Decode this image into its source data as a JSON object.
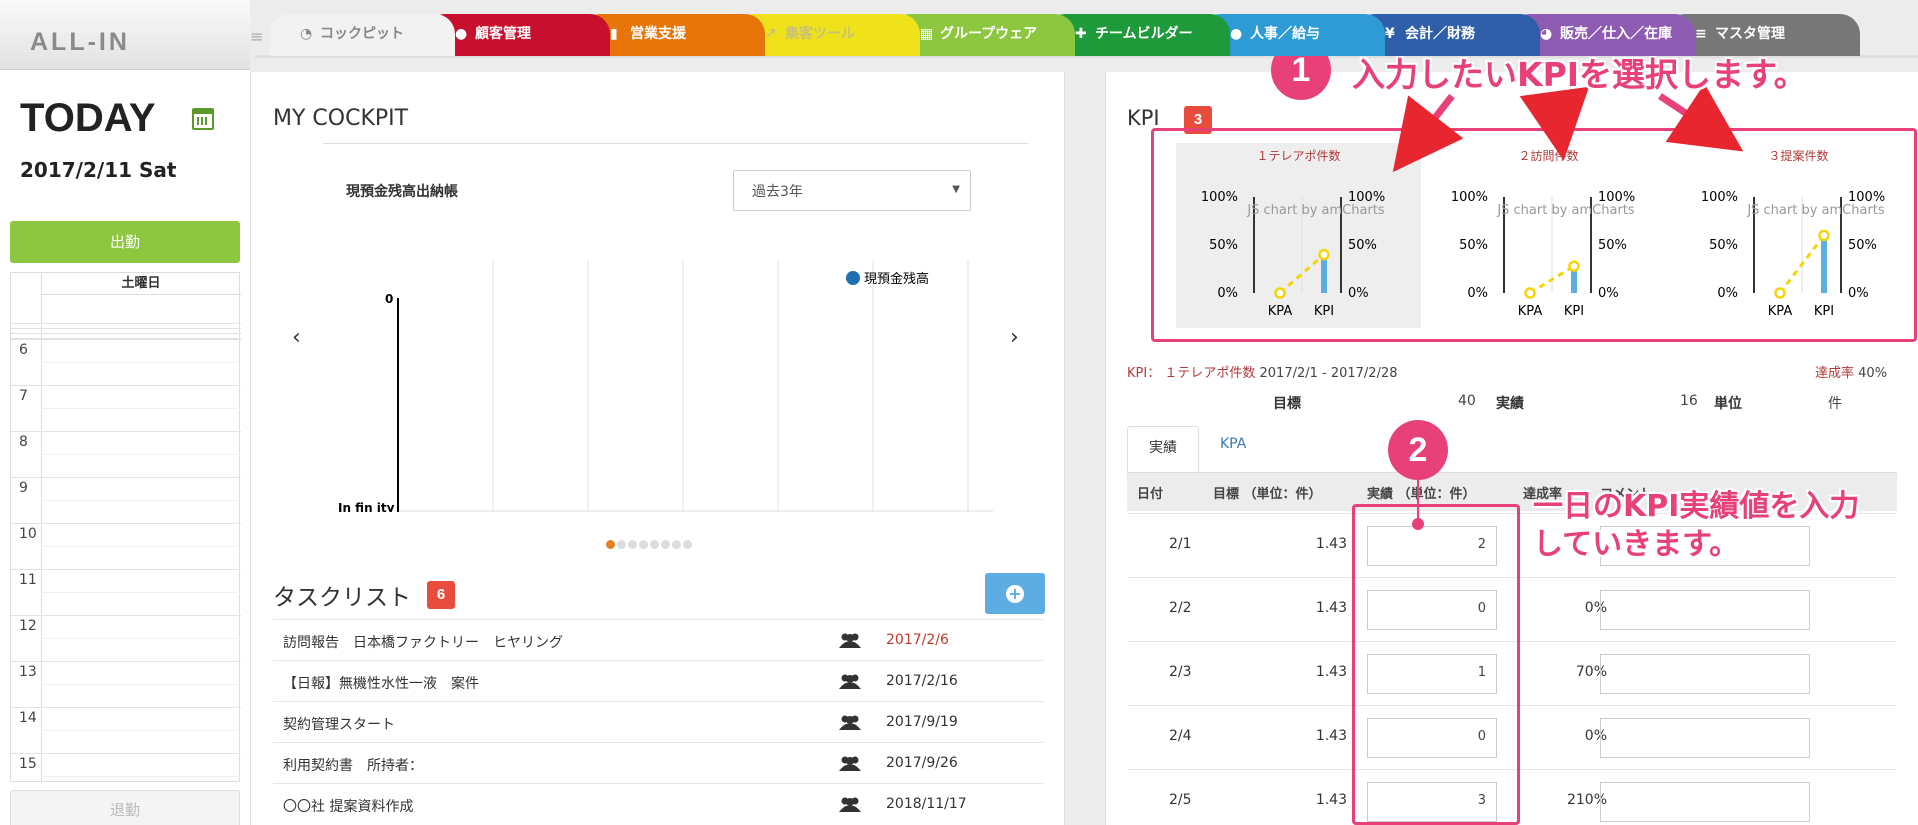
{
  "app": {
    "logo": "ALL-IN"
  },
  "tabs": [
    {
      "label": "コックピット",
      "color": "#f2f2f2",
      "text_color": "#888",
      "icon": "dashboard-icon",
      "glyph": "◔"
    },
    {
      "label": "顧客管理",
      "color": "#c8102e",
      "icon": "comments-icon",
      "glyph": "●"
    },
    {
      "label": "営業支援",
      "color": "#e8750a",
      "icon": "bar-chart-icon",
      "glyph": "▮"
    },
    {
      "label": "集客ツール",
      "color": "#f0e21a",
      "text_color": "#c9c17a",
      "icon": "line-chart-icon",
      "glyph": "↗"
    },
    {
      "label": "グループウェア",
      "color": "#8dc63f",
      "icon": "calendar-icon",
      "glyph": "▦"
    },
    {
      "label": "チームビルダー",
      "color": "#1f9a3a",
      "icon": "user-plus-icon",
      "glyph": "✚"
    },
    {
      "label": "人事／給与",
      "color": "#2e9bd6",
      "icon": "users-icon",
      "glyph": "●"
    },
    {
      "label": "会計／財務",
      "color": "#2f5fa8",
      "icon": "yen-icon",
      "glyph": "¥"
    },
    {
      "label": "販売／仕入／在庫",
      "color": "#8e5bb3",
      "icon": "pie-chart-icon",
      "glyph": "◕"
    },
    {
      "label": "マスタ管理",
      "color": "#777777",
      "icon": "database-icon",
      "glyph": "≡"
    }
  ],
  "today": {
    "title": "TODAY",
    "date": "2017/2/11 Sat",
    "checkin_label": "出勤",
    "checkout_label": "退勤",
    "day_header": "土曜日",
    "hours": [
      "6",
      "7",
      "8",
      "9",
      "10",
      "11",
      "12",
      "13",
      "14",
      "15"
    ]
  },
  "cockpit": {
    "title": "MY COCKPIT",
    "chart_label": "現預金残高出納帳",
    "period_selected": "過去3年",
    "legend": "現預金残高",
    "y_top_label": "0",
    "y_bottom_label": "In fin ity"
  },
  "tasks": {
    "title": "タスクリスト",
    "count": "6",
    "items": [
      {
        "name": "訪問報告　日本橋ファクトリー　ヒヤリング",
        "date": "2017/2/6",
        "overdue": true
      },
      {
        "name": "【日報】無機性水性一液　案件",
        "date": "2017/2/16",
        "overdue": false
      },
      {
        "name": "契約管理スタート",
        "date": "2017/9/19",
        "overdue": false
      },
      {
        "name": "利用契約書　所持者：",
        "date": "2017/9/26",
        "overdue": false
      },
      {
        "name": "〇〇社 提案資料作成",
        "date": "2018/11/17",
        "overdue": false
      }
    ]
  },
  "kpi": {
    "title": "KPI",
    "count": "3",
    "watermark": "JS chart by amCharts",
    "gauges": [
      {
        "title": "１テレアポ件数",
        "kpa": 0,
        "kpi": 40
      },
      {
        "title": "２訪問件数",
        "kpa": 0,
        "kpi": 28
      },
      {
        "title": "３提案件数",
        "kpa": 0,
        "kpi": 60
      }
    ],
    "axis_labels": [
      "100%",
      "50%",
      "0%"
    ],
    "x_labels": [
      "KPA",
      "KPI"
    ],
    "selected_prefix": "KPI：",
    "selected_name": "１テレアポ件数",
    "selected_range": "2017/2/1 - 2017/2/28",
    "rate_label": "達成率",
    "rate_value": "40%",
    "target_label": "目標",
    "target_value": "40",
    "actual_label": "実績",
    "actual_value": "16",
    "unit_label": "単位",
    "unit_value": "件",
    "tab_actual": "実績",
    "tab_kpa": "KPA",
    "columns": [
      "日付",
      "目標 （単位：件）",
      "実績 （単位：件）",
      "達成率",
      "コメント"
    ],
    "rows": [
      {
        "date": "2/1",
        "target": "1.43",
        "actual": "2",
        "rate": ""
      },
      {
        "date": "2/2",
        "target": "1.43",
        "actual": "0",
        "rate": "0%"
      },
      {
        "date": "2/3",
        "target": "1.43",
        "actual": "1",
        "rate": "70%"
      },
      {
        "date": "2/4",
        "target": "1.43",
        "actual": "0",
        "rate": "0%"
      },
      {
        "date": "2/5",
        "target": "1.43",
        "actual": "3",
        "rate": "210%"
      }
    ]
  },
  "annotations": {
    "step1_number": "1",
    "step1_text": "入力したいKPIを選択します。",
    "step2_number": "2",
    "step2_text": "一日のKPI実績値を入力していきます。",
    "accent": "#e8417a"
  }
}
